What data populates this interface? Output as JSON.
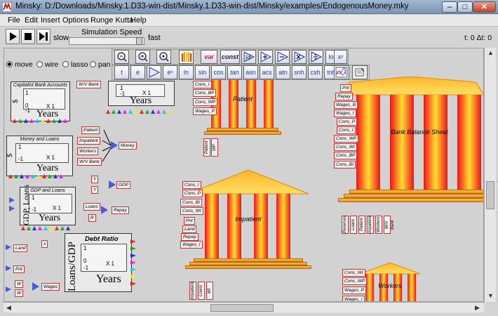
{
  "window": {
    "title": "Minsky: D:/Downloads/Minsky.1.D33-win-dist/Minsky.1.D33-win-dist/Minsky/examples/EndogenousMoney.mky",
    "minimize": "–",
    "maximize": "□",
    "close": "✕"
  },
  "menu": [
    "File",
    "Edit",
    "Insert",
    "Options",
    "Runge Kutta",
    "Help"
  ],
  "controls": {
    "slow": "slow",
    "speed_label": "Simulation Speed",
    "fast": "fast",
    "time": "t: 0  Δt: 0"
  },
  "modes": [
    "move",
    "wire",
    "lasso",
    "pan"
  ],
  "toolbar_top": [
    "zoom-out",
    "zoom-in",
    "zoom-reset",
    "godley",
    "var",
    "const",
    "integral",
    "plus",
    "minus",
    "multiply",
    "divide",
    "log",
    "pow"
  ],
  "toolbar_top_text": {
    "var": "var",
    "const": "const",
    "log": "log",
    "pow": "xʸ"
  },
  "toolbar_bottom": [
    "time",
    "euler",
    "copy",
    "exp",
    "ln",
    "sin",
    "cos",
    "tan",
    "asin",
    "acos",
    "atan",
    "sinh",
    "cosh",
    "tanh",
    "plot",
    "note"
  ],
  "toolbar_bottom_text": {
    "time": "t",
    "euler": "e",
    "exp": "eˣ",
    "ln": "ln",
    "sin": "sin",
    "cos": "cos",
    "tan": "tan",
    "asin": "asn",
    "acos": "acs",
    "atan": "atn",
    "sinh": "snh",
    "cosh": "csh",
    "tanh": "tnh"
  },
  "godley_tables": [
    {
      "title": "Capitalist Bank Accounts"
    },
    {
      "title": "Money and Loans"
    },
    {
      "title": "GDP and Loans"
    },
    {
      "title": "Debt Ratio"
    }
  ],
  "plot_labels": {
    "years": "Years",
    "ylabel_money": "$",
    "ylabel_gdp": "GDP, Loans",
    "ylabel_debt": "Loans/GDP",
    "tick_0": "0",
    "tick_1": "1",
    "tick_neg1": "-1",
    "x1": "X 1"
  },
  "variables_left": [
    "W/V Bank",
    "Patient",
    "Impatient",
    "Workers",
    "W/V Bank",
    "Y",
    "Loans",
    "R",
    "λ",
    "Land",
    "Pnt",
    "W",
    "Wages"
  ],
  "ops_outputs": [
    "Money",
    "GDP",
    "Repay"
  ],
  "banks": [
    {
      "name": "Patient",
      "vars": [
        "Cons_I",
        "Cons_BP",
        "Cons_WP",
        "Wages_P"
      ],
      "bottom_vars": [
        "Patient",
        "WP"
      ]
    },
    {
      "name": "Impatient",
      "vars": [
        "Cons_I",
        "Cons_P",
        "Cons_BI",
        "Cons_WI",
        "Pnt",
        "Land",
        "Repay",
        "Wages_I"
      ],
      "bottom_vars": [
        "Impatient",
        "Loans",
        "WI"
      ]
    },
    {
      "name": "Bank Balance Sheet",
      "vars": [
        "Pnt",
        "Repay",
        "Wages_B",
        "Wages_I",
        "Cons_P",
        "Cons_I",
        "Cons_WP",
        "Cons_WI",
        "Cons_BP",
        "Cons_BI"
      ],
      "bottom_vars": [
        "Reserves",
        "Loans",
        "Patient",
        "Impatient",
        "Workers",
        "W/V Bank"
      ]
    },
    {
      "name": "Workers",
      "vars": [
        "Cons_WI",
        "Cons_WP",
        "Wages_P",
        "Wages_I"
      ],
      "bottom_vars": []
    }
  ],
  "colors": {
    "titlebar": "#8aa3bf",
    "column": "#ff9d2a",
    "pediment": "#f7b93a",
    "port": "#4b5bd6",
    "var_border": "#cc3333"
  }
}
